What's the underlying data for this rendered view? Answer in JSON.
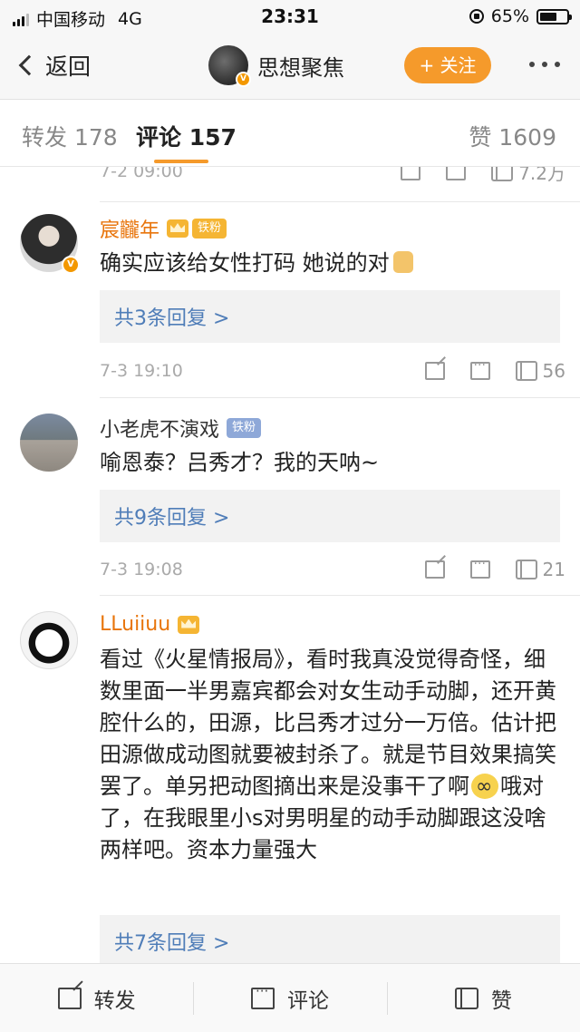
{
  "status_bar": {
    "carrier": "中国移动",
    "network": "4G",
    "time": "23:31",
    "battery": "65%",
    "battery_level": 0.65
  },
  "nav": {
    "back_label": "返回",
    "account_name": "思想聚焦",
    "follow_label": "+ 关注"
  },
  "tabs": {
    "repost": "转发 178",
    "comments": "评论 157",
    "likes": "赞 1609"
  },
  "partial_item": {
    "time": "7-2 09:00",
    "likes": "7.2万"
  },
  "comments": [
    {
      "name": "宸龖年",
      "badge": "铁粉",
      "text": "确实应该给女性打码 她说的对",
      "reply_link": "共3条回复 >",
      "time": "7-3 19:10",
      "likes": "56",
      "verified_badge": "V"
    },
    {
      "name": "小老虎不演戏",
      "badge": "铁粉",
      "text": "喻恩泰？吕秀才？我的天呐~",
      "reply_link": "共9条回复 >",
      "time": "7-3 19:08",
      "likes": "21"
    },
    {
      "name": "LLuiiuu",
      "text_before_emoji": "看过《火星情报局》，看时我真没觉得奇怪，细数里面一半男嘉宾都会对女生动手动脚，还开黄腔什么的，田源，比吕秀才过分一万倍。估计把田源做成动图就要被封杀了。就是节目效果搞笑罢了。单另把动图摘出来是没事干了啊",
      "text_after_emoji": "哦对了，在我眼里小s对男明星的动手动脚跟这没啥两样吧。资本力量强大",
      "reply_link": "共7条回复 >"
    }
  ],
  "bottom_bar": {
    "repost": "转发",
    "comment": "评论",
    "like": "赞"
  },
  "colors": {
    "accent": "#f59a2b",
    "name_orange": "#e8750c",
    "link_blue": "#4f7db8"
  }
}
